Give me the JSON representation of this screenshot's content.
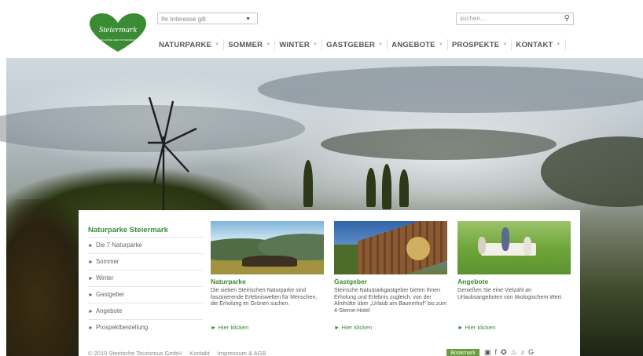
{
  "brand": {
    "logo_text": "Steiermark",
    "logo_tagline": "DAS GRÜNE HERZ ÖSTERREICHS",
    "color": "#3a8b34"
  },
  "header": {
    "interest_select": "Ihr Interesse gilt",
    "search_placeholder": "suchen...",
    "nav": [
      "NATURPARKE",
      "SOMMER",
      "WINTER",
      "GASTGEBER",
      "ANGEBOTE",
      "PROSPEKTE",
      "KONTAKT"
    ]
  },
  "sidebar": {
    "title": "Naturparke Steiermark",
    "items": [
      "Die 7 Naturparke",
      "Sommer",
      "Winter",
      "Gastgeber",
      "Angebote",
      "Prospektbestellung"
    ]
  },
  "cards": [
    {
      "title": "Naturparke",
      "desc": "Die sieben Steirischen Naturparke sind faszinierende Erlebniswelten für Menschen, die Erholung im Grünen suchen.",
      "link": "Hier klicken"
    },
    {
      "title": "Gastgeber",
      "desc": "Steirische Naturparkgastgeber bieten Ihnen Erholung und Erlebnis zugleich, von der Almhütte über „Urlaub am Bauernhof\" bis zum 4-Sterne-Hotel",
      "link": "Hier klicken"
    },
    {
      "title": "Angebote",
      "desc": "Genießen Sie eine Vielzahl an Urlaubsangeboten von ökologischem Wert.",
      "link": "Hier klicken"
    }
  ],
  "footer": {
    "copyright": "© 2010 Steirische Tourismus GmbH",
    "contact": "Kontakt",
    "imprint": "Impressum & AGB",
    "bookmark": "Bookmark"
  }
}
